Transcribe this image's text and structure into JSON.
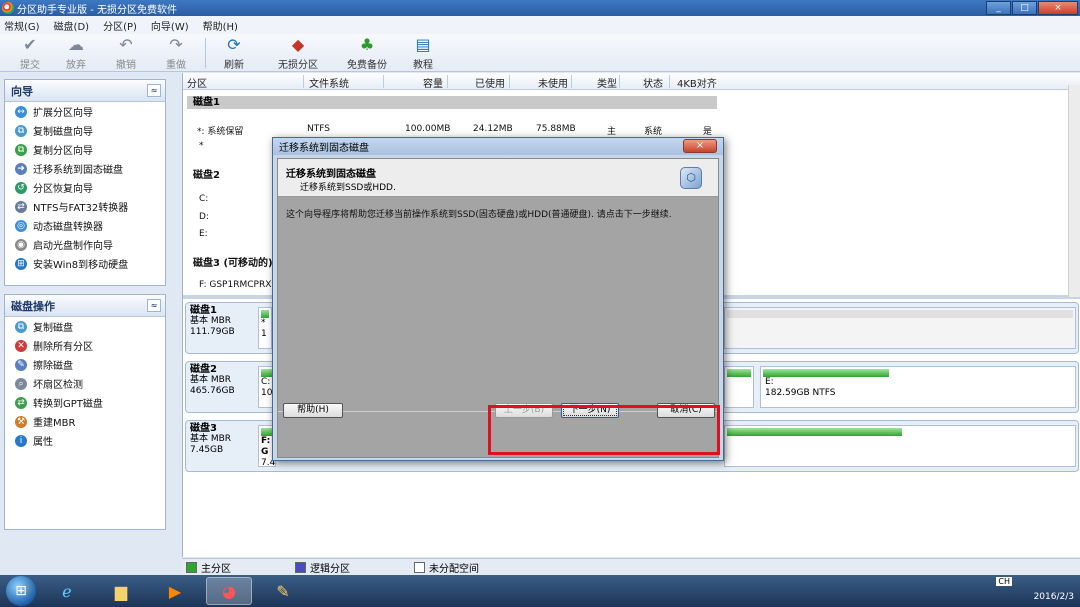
{
  "window": {
    "title": "分区助手专业版 - 无损分区免费软件",
    "buttons": [
      "_",
      "□",
      "×"
    ]
  },
  "menu": [
    "常规(G)",
    "磁盘(D)",
    "分区(P)",
    "向导(W)",
    "帮助(H)"
  ],
  "toolbar": [
    {
      "label": "提交",
      "icon": "check-icon",
      "glyph": "✔",
      "enabled": false
    },
    {
      "label": "放弃",
      "icon": "discard-icon",
      "glyph": "☁",
      "enabled": false
    },
    {
      "label": "撤销",
      "icon": "undo-icon",
      "glyph": "↶",
      "enabled": false
    },
    {
      "label": "重做",
      "icon": "redo-icon",
      "glyph": "↷",
      "enabled": false
    },
    {
      "label": "刷新",
      "icon": "refresh-icon",
      "glyph": "⟳",
      "enabled": true
    },
    {
      "label": "无损分区",
      "icon": "partition-icon",
      "glyph": "◆",
      "enabled": true
    },
    {
      "label": "免费备份",
      "icon": "backup-icon",
      "glyph": "♣",
      "enabled": true
    },
    {
      "label": "教程",
      "icon": "tutorial-icon",
      "glyph": "▤",
      "enabled": true
    }
  ],
  "wizard_panel": {
    "title": "向导",
    "collapse": "≈",
    "items": [
      "扩展分区向导",
      "复制磁盘向导",
      "复制分区向导",
      "迁移系统到固态磁盘",
      "分区恢复向导",
      "NTFS与FAT32转换器",
      "动态磁盘转换器",
      "启动光盘制作向导",
      "安装Win8到移动硬盘"
    ]
  },
  "disk_ops_panel": {
    "title": "磁盘操作",
    "collapse": "≈",
    "items": [
      "复制磁盘",
      "删除所有分区",
      "擦除磁盘",
      "坏扇区检测",
      "转换到GPT磁盘",
      "重建MBR",
      "属性"
    ]
  },
  "columns": [
    "分区",
    "文件系统",
    "容量",
    "已使用",
    "未使用",
    "类型",
    "状态",
    "4KB对齐"
  ],
  "disk_list": {
    "disk1": {
      "title": "磁盘1",
      "row1": {
        "name": "*: 系统保留",
        "fs": "NTFS",
        "capacity": "100.00MB",
        "used": "24.12MB",
        "free": "75.88MB",
        "type": "主",
        "status": "系统",
        "align": "是"
      },
      "row2_name": "*"
    },
    "disk2": {
      "title": "磁盘2",
      "partitions": [
        "C:",
        "D:",
        "E:"
      ]
    },
    "disk3": {
      "title": "磁盘3 (可移动的)",
      "partition": "F: GSP1RMCPRXF"
    }
  },
  "disk_map": [
    {
      "name": "磁盘1",
      "type": "基本 MBR",
      "size": "111.79GB",
      "part_label": "*",
      "part_size": "1"
    },
    {
      "name": "磁盘2",
      "type": "基本 MBR",
      "size": "465.76GB",
      "part_label": "C:",
      "part_size": "100",
      "right_label": "E:",
      "right_size": "182.59GB NTFS"
    },
    {
      "name": "磁盘3",
      "type": "基本 MBR",
      "size": "7.45GB",
      "part_label": "F: G",
      "part_size": "7.4"
    }
  ],
  "legend": [
    "主分区",
    "逻辑分区",
    "未分配空间"
  ],
  "dialog": {
    "title": "迁移系统到固态磁盘",
    "close": "×",
    "header_title": "迁移系统到固态磁盘",
    "header_subtitle": "迁移系统到SSD或HDD.",
    "description": "这个向导程序将帮助您迁移当前操作系统到SSD(固态硬盘)或HDD(普通硬盘). 请点击下一步继续.",
    "help_button": "帮助(H)",
    "prev_button": "上一步(B)",
    "next_button": "下一步(N)",
    "cancel_button": "取消(C)"
  },
  "taskbar": {
    "lang": "CH",
    "date": "2016/2/3",
    "start": "⊞"
  }
}
